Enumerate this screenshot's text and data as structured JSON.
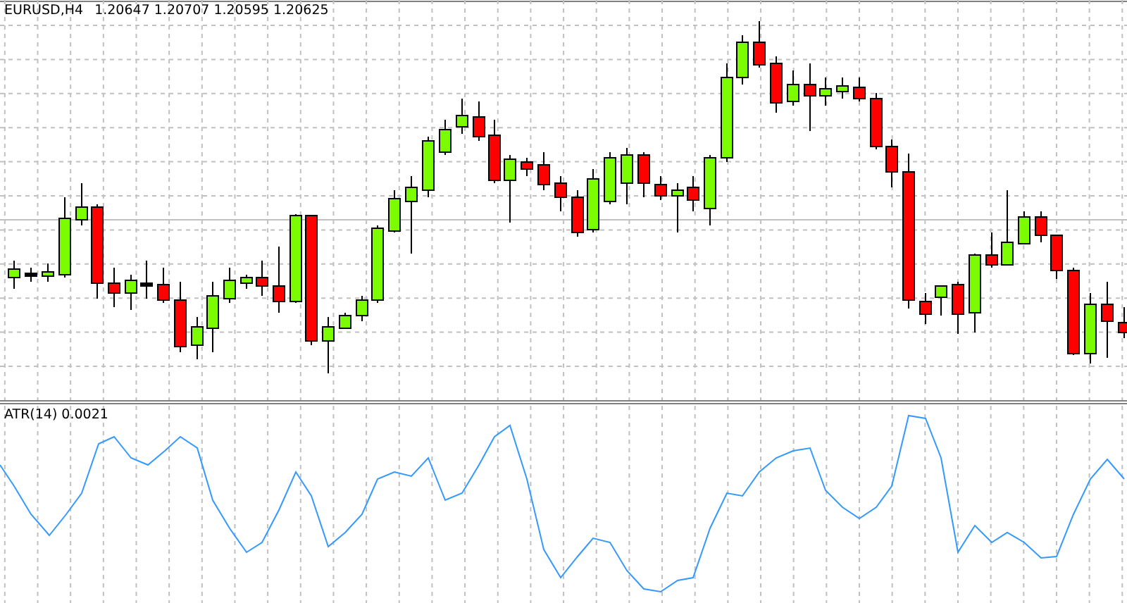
{
  "main_chart": {
    "symbol": "EURUSD,H4",
    "prices": "1.20647 1.20707 1.20595 1.20625"
  },
  "indicator": {
    "label": "ATR(14) 0.0021"
  }
}
